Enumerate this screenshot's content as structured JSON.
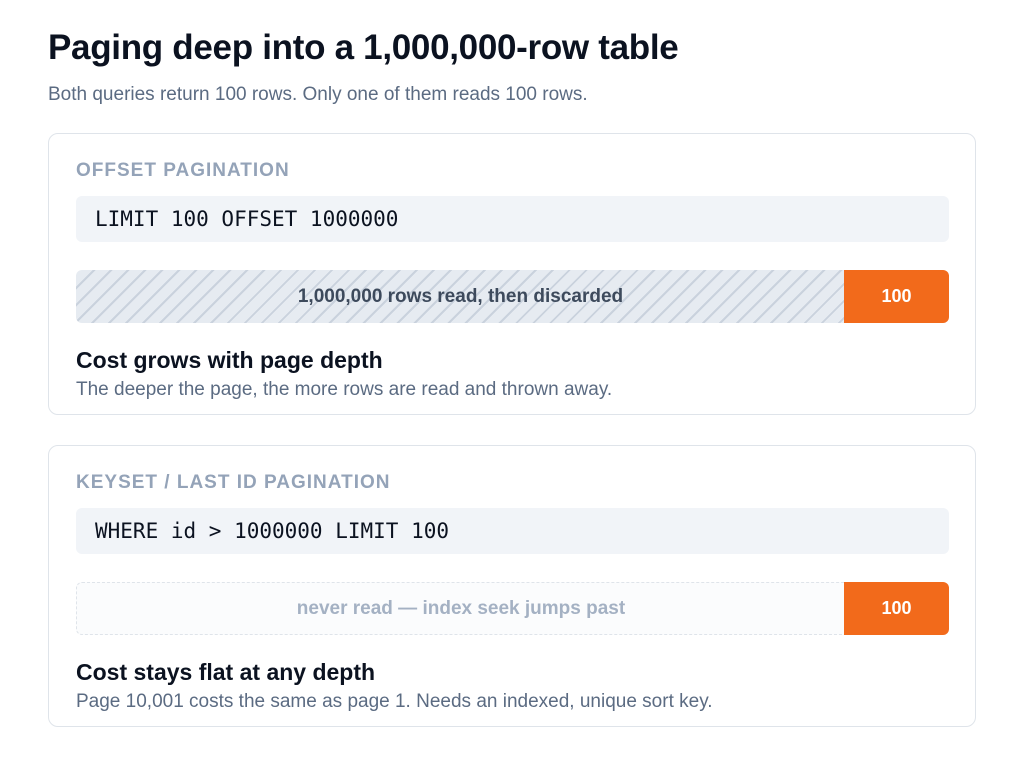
{
  "header": {
    "title": "Paging deep into a 1,000,000-row table",
    "subtitle": "Both queries return 100 rows. Only one of them reads 100 rows."
  },
  "cards": [
    {
      "label": "OFFSET PAGINATION",
      "code": "LIMIT 100 OFFSET 1000000",
      "bar": {
        "skipped_text": "1,000,000 rows read, then discarded",
        "read_text": "100",
        "skipped_style": "striped"
      },
      "heading": "Cost grows with page depth",
      "description": "The deeper the page, the more rows are read and thrown away."
    },
    {
      "label": "KEYSET / LAST ID PAGINATION",
      "code": "WHERE id > 1000000 LIMIT 100",
      "bar": {
        "skipped_text": "never read — index seek jumps past",
        "read_text": "100",
        "skipped_style": "dashed"
      },
      "heading": "Cost stays flat at any depth",
      "description": "Page 10,001 costs the same as page 1. Needs an indexed, unique sort key."
    }
  ],
  "colors": {
    "accent": "#f26a1b",
    "muted_label": "#94a3b8",
    "body_text": "#5b6b82",
    "code_bg": "#f1f4f8"
  }
}
